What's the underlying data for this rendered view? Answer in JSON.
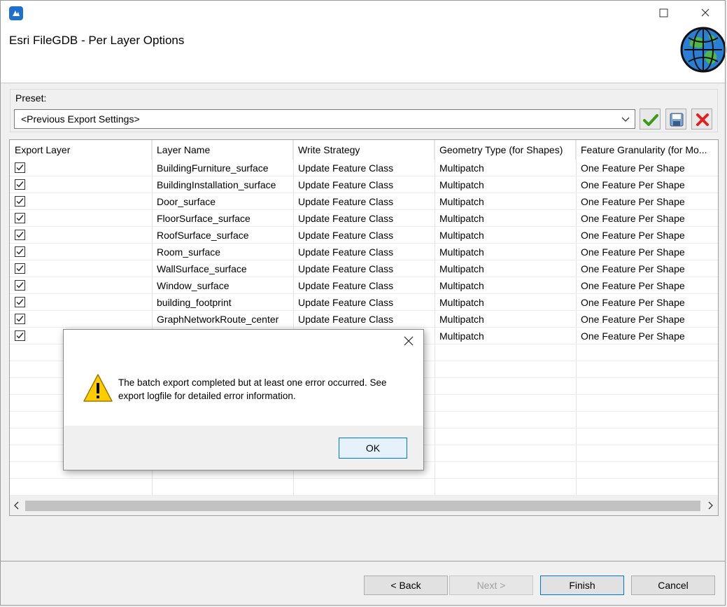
{
  "window": {
    "title": "Esri FileGDB - Per Layer Options"
  },
  "preset": {
    "label": "Preset:",
    "value": "<Previous Export Settings>"
  },
  "table": {
    "columns": [
      "Export Layer",
      "Layer Name",
      "Write Strategy",
      "Geometry Type (for Shapes)",
      "Feature Granularity (for Mo..."
    ],
    "rows": [
      {
        "checked": true,
        "name": "BuildingFurniture_surface",
        "strategy": "Update Feature Class",
        "geometry": "Multipatch",
        "granularity": "One Feature Per Shape"
      },
      {
        "checked": true,
        "name": "BuildingInstallation_surface",
        "strategy": "Update Feature Class",
        "geometry": "Multipatch",
        "granularity": "One Feature Per Shape"
      },
      {
        "checked": true,
        "name": "Door_surface",
        "strategy": "Update Feature Class",
        "geometry": "Multipatch",
        "granularity": "One Feature Per Shape"
      },
      {
        "checked": true,
        "name": "FloorSurface_surface",
        "strategy": "Update Feature Class",
        "geometry": "Multipatch",
        "granularity": "One Feature Per Shape"
      },
      {
        "checked": true,
        "name": "RoofSurface_surface",
        "strategy": "Update Feature Class",
        "geometry": "Multipatch",
        "granularity": "One Feature Per Shape"
      },
      {
        "checked": true,
        "name": "Room_surface",
        "strategy": "Update Feature Class",
        "geometry": "Multipatch",
        "granularity": "One Feature Per Shape"
      },
      {
        "checked": true,
        "name": "WallSurface_surface",
        "strategy": "Update Feature Class",
        "geometry": "Multipatch",
        "granularity": "One Feature Per Shape"
      },
      {
        "checked": true,
        "name": "Window_surface",
        "strategy": "Update Feature Class",
        "geometry": "Multipatch",
        "granularity": "One Feature Per Shape"
      },
      {
        "checked": true,
        "name": "building_footprint",
        "strategy": "Update Feature Class",
        "geometry": "Multipatch",
        "granularity": "One Feature Per Shape"
      },
      {
        "checked": true,
        "name": "GraphNetworkRoute_center",
        "strategy": "Update Feature Class",
        "geometry": "Multipatch",
        "granularity": "One Feature Per Shape"
      },
      {
        "checked": true,
        "name": "",
        "strategy": "",
        "geometry": "Multipatch",
        "granularity": "One Feature Per Shape"
      }
    ]
  },
  "buttons": {
    "back": "< Back",
    "next": "Next >",
    "finish": "Finish",
    "cancel": "Cancel"
  },
  "modal": {
    "message": "The batch export completed but at least one error occurred. See export logfile for detailed error information.",
    "ok": "OK"
  },
  "icons": {
    "app": "app-icon",
    "globe": "globe-icon",
    "apply": "checkmark-icon",
    "save": "save-icon",
    "delete": "delete-icon",
    "warning": "warning-icon"
  },
  "colors": {
    "accent": "#0078d7",
    "delete": "#e02020",
    "apply": "#3a9a1a",
    "warning": "#ffcc00"
  }
}
